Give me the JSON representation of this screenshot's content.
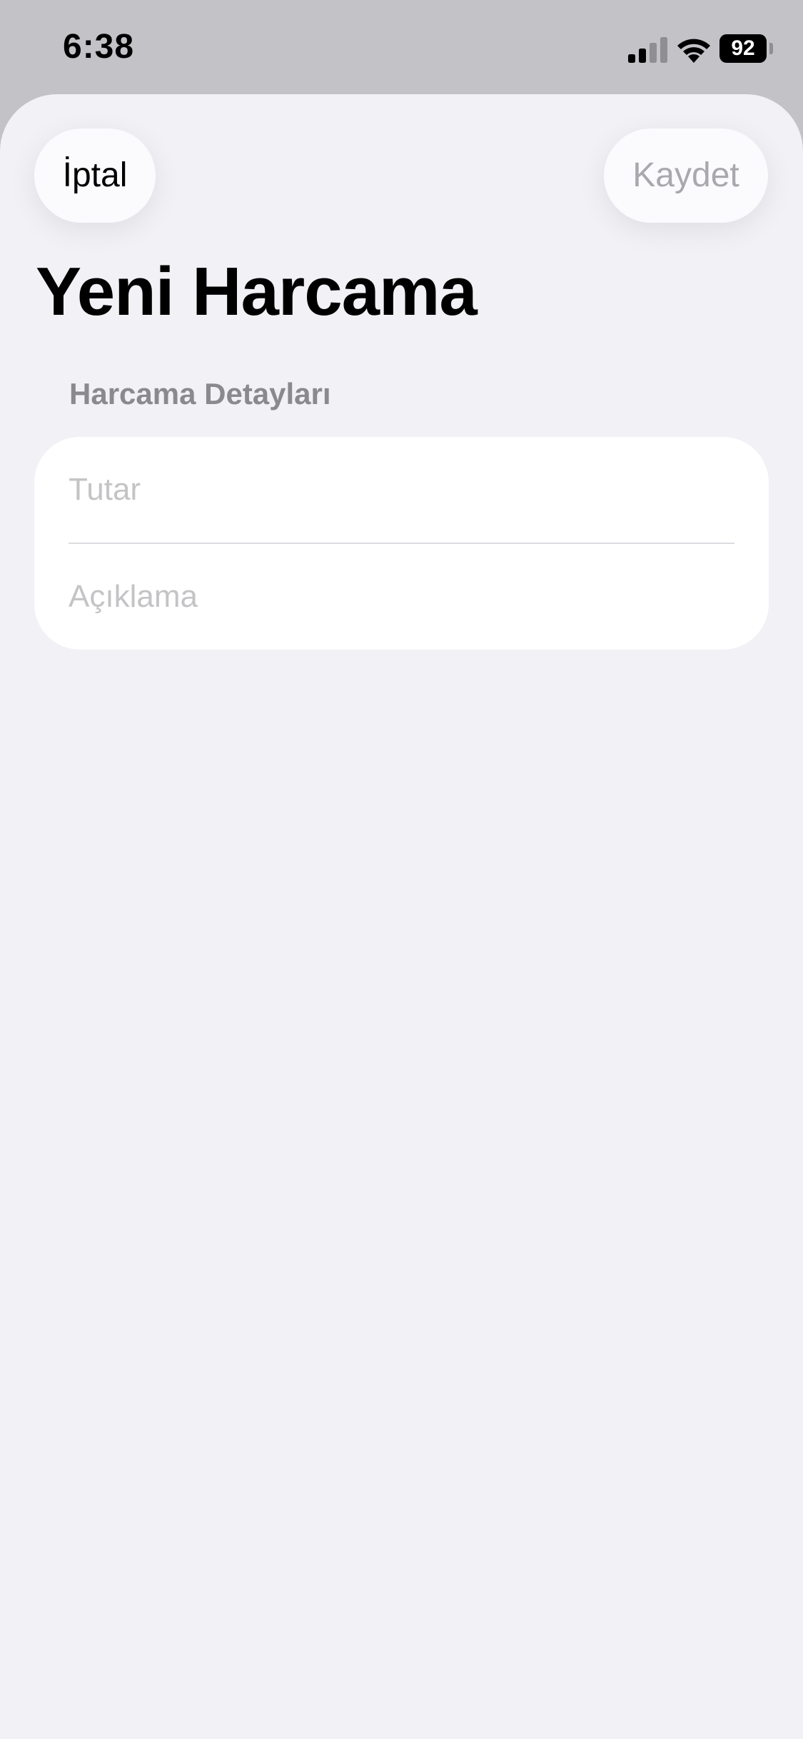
{
  "status_bar": {
    "time": "6:38",
    "battery_level": "92",
    "icons": [
      "signal-icon",
      "wifi-icon",
      "battery-icon"
    ]
  },
  "nav": {
    "cancel_label": "İptal",
    "save_label": "Kaydet"
  },
  "page": {
    "title": "Yeni Harcama"
  },
  "form": {
    "section_header": "Harcama Detayları",
    "amount": {
      "value": "",
      "placeholder": "Tutar"
    },
    "description": {
      "value": "",
      "placeholder": "Açıklama"
    }
  },
  "colors": {
    "background": "#f1f1f6",
    "status_background": "#c2c2c7",
    "placeholder": "#c4c4c7",
    "disabled_text": "#a9a9ad",
    "section_header": "#8a8a8e"
  }
}
